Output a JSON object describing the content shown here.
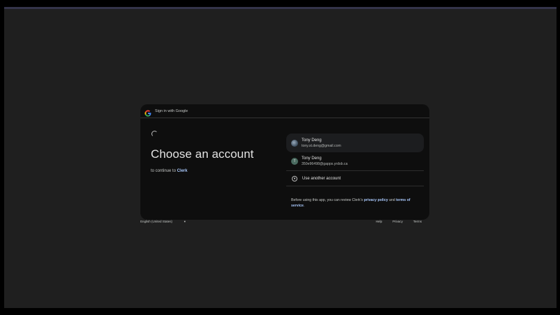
{
  "header": {
    "title": "Sign in with Google",
    "logo_icon": "google-g-icon"
  },
  "main": {
    "heading": "Choose an account",
    "subtitle_prefix": "to continue to",
    "app_name": "Clerk"
  },
  "accounts": [
    {
      "name": "Tony Deng",
      "email": "tony.st.deng@gmail.com",
      "avatar": "photo"
    },
    {
      "name": "Tony Deng",
      "email": "350e96498@gapps.yrdsb.ca",
      "avatar_letter": "T"
    }
  ],
  "other_account": {
    "label": "Use another account",
    "icon": "person-circle-icon"
  },
  "policy": {
    "prefix": "Before using this app, you can review Clerk’s",
    "privacy_link": "privacy policy",
    "and": "and",
    "terms_link": "terms of service",
    "suffix": "."
  },
  "footer": {
    "language": "English (United States)",
    "links": [
      "Help",
      "Privacy",
      "Terms"
    ]
  },
  "colors": {
    "accent": "#a8c7fa",
    "card_bg": "#0e0e0e",
    "page_bg": "#1f1f1f"
  }
}
